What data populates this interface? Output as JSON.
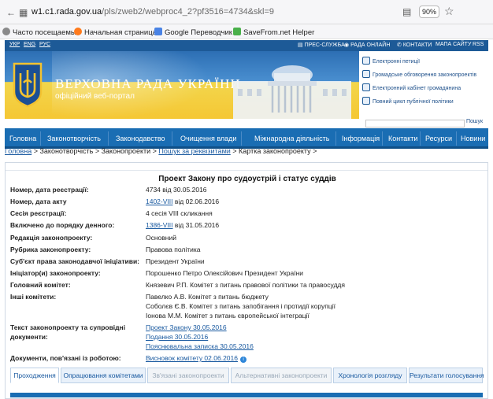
{
  "browser": {
    "url_host": "w1.c1.rada.gov.ua",
    "url_path": "/pls/zweb2/webproc4_2?pf3516=4734&skl=9",
    "zoom": "90%",
    "bookmarks": [
      {
        "label": "Часто посещаемые",
        "icon": "gear-icon"
      },
      {
        "label": "Начальная страница",
        "icon": "firefox-icon"
      },
      {
        "label": "Google Переводчик",
        "icon": "translate-icon"
      },
      {
        "label": "SaveFrom.net Helper",
        "icon": "savefrom-icon"
      }
    ]
  },
  "site": {
    "langs": [
      "УКР",
      "ENG",
      "РУС"
    ],
    "top_links": [
      "ПРЕС-СЛУЖБА",
      "РАДА ОНЛАЙН",
      "КОНТАКТИ",
      "МАПА САЙТУ",
      "RSS"
    ],
    "title": "ВЕРХОВНА РАДА УКРАЇНИ",
    "subtitle": "офіційний веб-портал",
    "side_links": [
      "Електронні петиції",
      "Громадське обговорення законопроектів",
      "Електронний кабінет громадянина",
      "Повний цикл публічної політики"
    ],
    "search_button": "Пошук",
    "nav": [
      "Головна",
      "Законотворчість",
      "Законодавство",
      "Очищення влади",
      "Міжнародна діяльність",
      "Інформація",
      "Контакти",
      "Ресурси",
      "Новини"
    ]
  },
  "breadcrumb": {
    "home": "Головна",
    "s1": " > Законотворчість > Законопроекти > ",
    "search": "Пошук за реквізитами",
    "s2": " > Картка законопроекту >"
  },
  "card": {
    "title": "Проект Закону про судоустрій і статус суддів",
    "reg_no_label": "Номер, дата реєстрації:",
    "reg_no_value": "4734 від 30.05.2016",
    "act_label": "Номер, дата акту",
    "act_link": "1402-VIII",
    "act_rest": " від 02.06.2016",
    "session_label": "Сесія реєстрації:",
    "session_value": "4 сесія VIII скликання",
    "agenda_label": "Включено до порядку денного:",
    "agenda_link": "1386-VIII",
    "agenda_rest": "  від 31.05.2016",
    "edition_label": "Редакція законопроекту:",
    "edition_value": "Основний",
    "rubric_label": "Рубрика законопроекту:",
    "rubric_value": "Правова політика",
    "subject_label": "Суб'єкт права законодавчої ініціативи:",
    "subject_value": "Президент України",
    "initiator_label": "Ініціатор(и) законопроекту:",
    "initiator_value": "Порошенко Петро Олексійович Президент України",
    "main_committee_label": "Головний комітет:",
    "main_committee_value": "Князевич Р.П. Комітет з питань правової політики та правосуддя",
    "other_committees_label": "Інші комітети:",
    "other_committees": [
      "Павелко А.В. Комітет з питань бюджету",
      "Соболєв Є.В. Комітет з питань запобігання і протидії корупції",
      "Іонова М.М. Комітет з питань європейської інтеграції"
    ],
    "texts_label_1": "Текст законопроекту та супровідні",
    "texts_label_2": "документи:",
    "texts_links": [
      "Проект Закону 30.05.2016",
      "Подання 30.05.2016",
      "Пояснювальна записка 30.05.2016"
    ],
    "related_label": "Документи, пов'язані із роботою:",
    "related_link": "Висновок комітету 02.06.2016",
    "tabs": [
      {
        "label": "Проходження",
        "state": "active"
      },
      {
        "label": "Опрацювання комітетами",
        "state": "normal"
      },
      {
        "label": "Зв'язані законопроекти",
        "state": "disabled"
      },
      {
        "label": "Альтернативні законопроекти",
        "state": "disabled"
      },
      {
        "label": "Хронологія розгляду",
        "state": "normal"
      },
      {
        "label": "Результати голосування",
        "state": "normal"
      }
    ]
  }
}
